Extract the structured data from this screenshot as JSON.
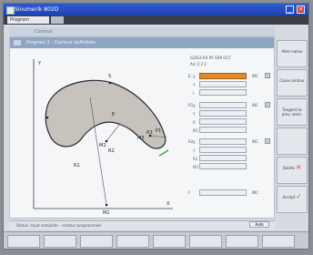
{
  "window": {
    "title": "Sinumerik 802D",
    "minimize": "_",
    "close": "×"
  },
  "menubar": {
    "item1": "Program"
  },
  "subbar": {
    "text": "Contour"
  },
  "panel": {
    "title": "Program 1 : Contour definition"
  },
  "drawing": {
    "labels": [
      "Y",
      "X",
      "R1",
      "R2",
      "R3",
      "M1",
      "M2",
      "M3",
      "P1",
      "S",
      "E"
    ]
  },
  "readout": {
    "header_line1": "G2/G3 RX RY  G90  G17",
    "header_line2": "Arc  2 2 2",
    "groups": [
      {
        "label": "E.",
        "rows": [
          "X",
          "Y",
          "I"
        ]
      },
      {
        "label": "R1",
        "rows": [
          "X",
          "Y",
          "R",
          "M1"
        ]
      },
      {
        "label": "R2",
        "rows": [
          "X",
          "Y",
          "R2",
          "M2"
        ]
      },
      {
        "label": "F",
        "rows": []
      }
    ],
    "tags": [
      "INC",
      "INC",
      "INC",
      "INC"
    ]
  },
  "sidebuttons": [
    {
      "label": "Alter-native"
    },
    {
      "label": "Close contour"
    },
    {
      "label": "Tangent to prev. elem."
    },
    {
      "label": ""
    },
    {
      "label": "Delete"
    },
    {
      "label": "Accept"
    }
  ],
  "status": {
    "text": "Status: Input complete – contour programmed",
    "btn": "Auto"
  },
  "accent": "#e08a2a",
  "titlebar_color": "#1f48b6"
}
